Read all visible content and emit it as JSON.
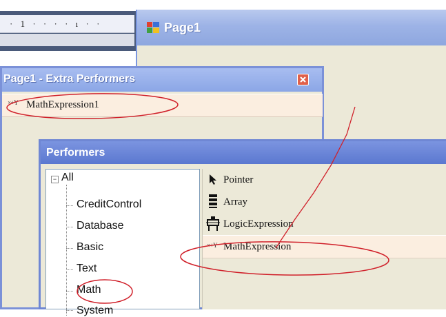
{
  "ruler": {
    "text": "· 1 · · · · ı · ·"
  },
  "page1_window": {
    "title": "Page1",
    "icon": "form-icon"
  },
  "extra_performers": {
    "title": "Page1 - Extra Performers",
    "close_icon": "close-icon",
    "items": [
      {
        "icon": "x+y-icon",
        "icon_text": "×+Y",
        "label": "MathExpression1"
      }
    ]
  },
  "performers": {
    "title": "Performers",
    "tree": {
      "expander": "−",
      "root": "All",
      "children": [
        "CreditControl",
        "Database",
        "Basic",
        "Text",
        "Math",
        "System"
      ]
    },
    "list": [
      {
        "icon": "pointer-icon",
        "label": "Pointer"
      },
      {
        "icon": "array-icon",
        "label": "Array"
      },
      {
        "icon": "logic-expression-icon",
        "label": "LogicExpression"
      },
      {
        "icon": "x+y-icon",
        "icon_text": "×+Y",
        "label": "MathExpression"
      }
    ]
  },
  "colors": {
    "annotation_red": "#d0202a",
    "title_blue": "#5b78d0",
    "window_bg": "#ece9d8"
  }
}
